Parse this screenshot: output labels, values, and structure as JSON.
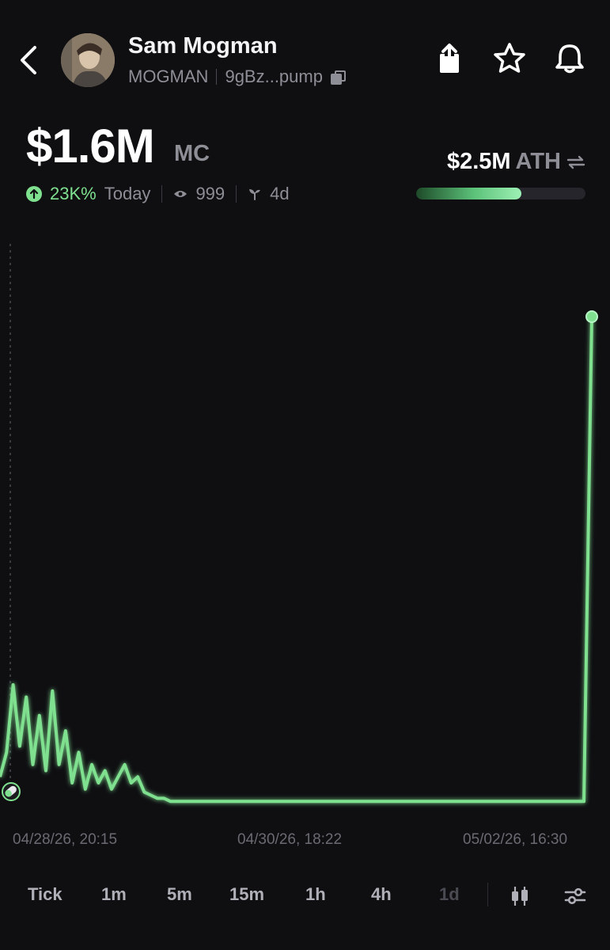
{
  "header": {
    "token_name": "Sam Mogman",
    "ticker": "MOGMAN",
    "address_short": "9gBz...pump",
    "icons": [
      "back-chevron-icon",
      "avatar",
      "copy-icon",
      "share-icon",
      "star-icon",
      "bell-icon"
    ]
  },
  "market": {
    "mc_value": "$1.6M",
    "mc_label": "MC",
    "change_pct": "23K%",
    "change_period": "Today",
    "views": "999",
    "age": "4d",
    "ath_value": "$2.5M",
    "ath_label": "ATH",
    "ath_progress": 0.62
  },
  "colors": {
    "background": "#0f0f12",
    "accent_green": "#7fe08f",
    "muted_text": "#8e8e96"
  },
  "chart_data": {
    "type": "line",
    "x_labels": [
      "04/28/26, 20:15",
      "04/30/26, 18:22",
      "05/02/26, 16:30"
    ],
    "values": [
      0.1,
      0.18,
      0.4,
      0.2,
      0.36,
      0.14,
      0.3,
      0.12,
      0.38,
      0.14,
      0.25,
      0.08,
      0.18,
      0.06,
      0.14,
      0.08,
      0.12,
      0.06,
      0.1,
      0.14,
      0.08,
      0.1,
      0.05,
      0.04,
      0.03,
      0.03,
      0.02,
      0.02,
      0.02,
      0.02,
      0.02,
      0.02,
      0.02,
      0.02,
      0.02,
      0.02,
      0.02,
      0.02,
      0.02,
      0.02,
      0.02,
      0.02,
      0.02,
      0.02,
      0.02,
      0.02,
      0.02,
      0.02,
      0.02,
      0.02,
      0.02,
      0.02,
      0.02,
      0.02,
      0.02,
      0.02,
      0.02,
      0.02,
      0.02,
      0.02,
      0.02,
      0.02,
      0.02,
      0.02,
      0.02,
      0.02,
      0.02,
      0.02,
      0.02,
      0.02,
      0.02,
      0.02,
      0.02,
      0.02,
      0.02,
      0.02,
      0.02,
      0.02,
      0.02,
      0.02,
      0.02,
      0.02,
      0.02,
      0.02,
      0.02,
      0.02,
      0.02,
      0.02,
      0.02,
      0.02,
      1.6
    ],
    "ylim": [
      0,
      1.6
    ],
    "grid": false,
    "line_color": "#7fe08f"
  },
  "timeframes": {
    "items": [
      "Tick",
      "1m",
      "5m",
      "15m",
      "1h",
      "4h",
      "1d"
    ],
    "selected": "1d"
  }
}
